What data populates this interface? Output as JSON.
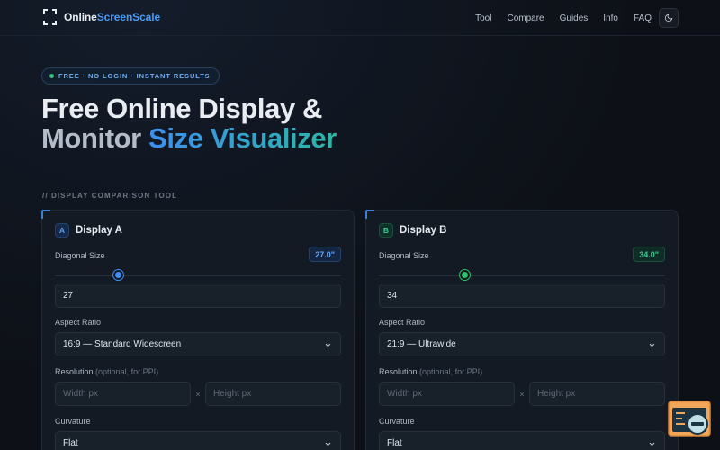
{
  "header": {
    "logo_main": "Online",
    "logo_accent": "ScreenScale",
    "nav": [
      "Tool",
      "Compare",
      "Guides",
      "Info",
      "FAQ"
    ]
  },
  "hero": {
    "badge": "FREE · NO LOGIN · INSTANT RESULTS",
    "title_line1": "Free Online Display &",
    "title_line2_plain": "Monitor ",
    "title_line2_accent": "Size Visualizer"
  },
  "section_label": "// DISPLAY COMPARISON TOOL",
  "displays": [
    {
      "tag": "A",
      "title": "Display A",
      "diagonal_label": "Diagonal Size",
      "diagonal_badge": "27.0\"",
      "diagonal_value": "27",
      "slider_fraction": 0.22,
      "aspect_label": "Aspect Ratio",
      "aspect_value": "16:9 — Standard Widescreen",
      "resolution_label": "Resolution",
      "resolution_hint": "(optional, for PPI)",
      "width_placeholder": "Width px",
      "height_placeholder": "Height px",
      "times": "×",
      "curvature_label": "Curvature",
      "curvature_value": "Flat"
    },
    {
      "tag": "B",
      "title": "Display B",
      "diagonal_label": "Diagonal Size",
      "diagonal_badge": "34.0\"",
      "diagonal_value": "34",
      "slider_fraction": 0.3,
      "aspect_label": "Aspect Ratio",
      "aspect_value": "21:9 — Ultrawide",
      "resolution_label": "Resolution",
      "resolution_hint": "(optional, for PPI)",
      "width_placeholder": "Width px",
      "height_placeholder": "Height px",
      "times": "×",
      "curvature_label": "Curvature",
      "curvature_value": "Flat"
    }
  ],
  "colors": {
    "accent_a": "#3b8ff2",
    "accent_b": "#2fbf71",
    "background": "#0d1117"
  }
}
